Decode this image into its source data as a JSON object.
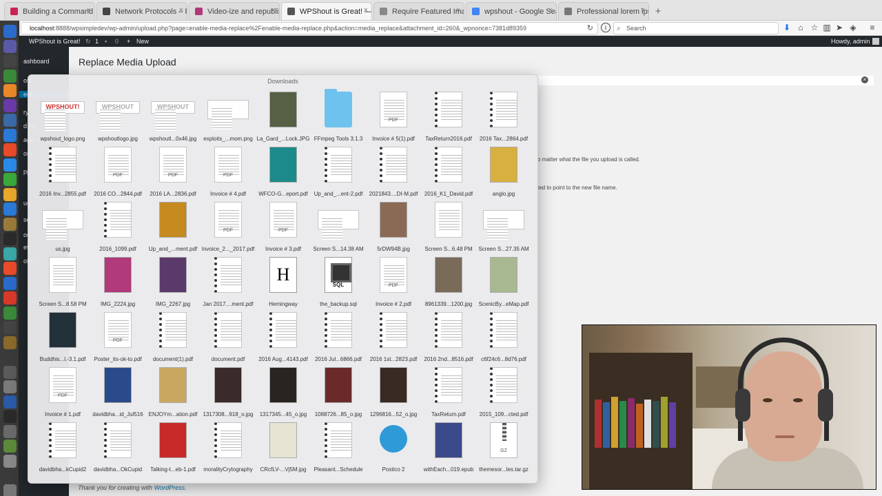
{
  "browser": {
    "tabs": [
      {
        "title": "Building a Command Line Da",
        "color": "#cc2255"
      },
      {
        "title": "Network Protocols – Program",
        "color": "#444444"
      },
      {
        "title": "Video-ize and republish this",
        "color": "#b0397a"
      },
      {
        "title": "WPShout is Great! — WordPres",
        "color": "#555555",
        "active": true
      },
      {
        "title": "Require Featured Image Page ‹ W",
        "color": "#888888"
      },
      {
        "title": "wpshout - Google Search",
        "color": "#4285f4"
      },
      {
        "title": "Professional lorem ipsum gen",
        "color": "#777777"
      }
    ],
    "new_tab": "+",
    "close_glyph": "×",
    "url_host": "localhost",
    "url_rest": ":8888/wpsimpledev/wp-admin/upload.php?page=enable-media-replace%2Fenable-media-replace.php&action=media_replace&attachment_id=260&_wpnonce=7381d89359",
    "search_placeholder": "Search"
  },
  "admin_bar": {
    "site_name": "WPShout is Great!",
    "updates": "1",
    "comments": "0",
    "new_label": "New",
    "greeting": "Howdy, admin"
  },
  "wp_menu": {
    "items": [
      "ashboard",
      "ost",
      "edi",
      "ry",
      "d Ne",
      "age",
      "om",
      "pp",
      "ug",
      "se",
      "oo",
      "ett",
      "olla"
    ]
  },
  "page": {
    "title": "Replace Media Upload",
    "text1": "o matter what the file you upload is called.",
    "text2": "ted to point to the new file name.",
    "footer_prefix": "Thank you for creating with",
    "footer_link": "WordPress",
    "footer_suffix": "."
  },
  "stack": {
    "title": "Downloads",
    "items": [
      {
        "name": "wpshout_logo.png",
        "kind": "logo",
        "label": "WPSHOUT!"
      },
      {
        "name": "wpshoutlogo.jpg",
        "kind": "logo",
        "label": "WPSHOUT"
      },
      {
        "name": "wpshoutl...0x46.jpg",
        "kind": "logo",
        "label": "WPSHOUT"
      },
      {
        "name": "exploits_...mom.png",
        "kind": "wide"
      },
      {
        "name": "La_Gard_...Lock.JPG",
        "kind": "photo",
        "color": "#556044"
      },
      {
        "name": "FFmpeg Tools 3.1.3",
        "kind": "folder"
      },
      {
        "name": "Invoice # 5(1).pdf",
        "kind": "pdf",
        "label": "PDF"
      },
      {
        "name": "TaxReturn2016.pdf",
        "kind": "spiral"
      },
      {
        "name": "2016 Tax...2864.pdf",
        "kind": "spiral"
      },
      {
        "name": "2016 Inv...2855.pdf",
        "kind": "spiral"
      },
      {
        "name": "2016 CO...2844.pdf",
        "kind": "pdf",
        "label": "PDF"
      },
      {
        "name": "2016 LA...2836.pdf",
        "kind": "pdf",
        "label": "PDF"
      },
      {
        "name": "Invoice # 4.pdf",
        "kind": "pdf",
        "label": "PDF"
      },
      {
        "name": "WFCO-G...eport.pdf",
        "kind": "photo",
        "color": "#1c8a8a"
      },
      {
        "name": "Up_and_...ent-2.pdf",
        "kind": "spiral"
      },
      {
        "name": "2021843....DI-M.pdf",
        "kind": "spiral"
      },
      {
        "name": "2016_K1_David.pdf",
        "kind": "spiral"
      },
      {
        "name": "anglo.jpg",
        "kind": "photo",
        "color": "#d8b040"
      },
      {
        "name": "us.jpg",
        "kind": "wide"
      },
      {
        "name": "2016_1099.pdf",
        "kind": "spiral"
      },
      {
        "name": "Up_and_...ment.pdf",
        "kind": "photo",
        "color": "#c58a20"
      },
      {
        "name": "Invoice_2..._2017.pdf",
        "kind": "pdf",
        "label": "PDF"
      },
      {
        "name": "Invoice # 3.pdf",
        "kind": "pdf",
        "label": "PDF"
      },
      {
        "name": "Screen S...14.38 AM",
        "kind": "wide"
      },
      {
        "name": "5rDW94B.jpg",
        "kind": "photo",
        "color": "#8a6a55"
      },
      {
        "name": "Screen S...6.48 PM",
        "kind": "doc"
      },
      {
        "name": "Screen S...27.35 AM",
        "kind": "wide"
      },
      {
        "name": "Screen S...8.58 PM",
        "kind": "doc"
      },
      {
        "name": "IMG_2224.jpg",
        "kind": "photo",
        "color": "#b03a7a"
      },
      {
        "name": "IMG_2267.jpg",
        "kind": "photo",
        "color": "#5a3a6a"
      },
      {
        "name": "Jan 2017....ment.pdf",
        "kind": "spiral"
      },
      {
        "name": "Hemingway",
        "kind": "hem",
        "label": "H"
      },
      {
        "name": "the_backup.sql",
        "kind": "sql",
        "label": "SQL"
      },
      {
        "name": "Invoice # 2.pdf",
        "kind": "pdf",
        "label": "PDF"
      },
      {
        "name": "8961339...1200.jpg",
        "kind": "photo",
        "color": "#7a6a58"
      },
      {
        "name": "ScenicBy...eMap.pdf",
        "kind": "photo",
        "color": "#a8b890"
      },
      {
        "name": "Buddhis...l.-3.1.pdf",
        "kind": "photo",
        "color": "#22303a"
      },
      {
        "name": "Poster_its-ok-to.pdf",
        "kind": "pdf",
        "label": "PDF"
      },
      {
        "name": "document(1).pdf",
        "kind": "spiral"
      },
      {
        "name": "document.pdf",
        "kind": "spiral"
      },
      {
        "name": "2016 Aug...4143.pdf",
        "kind": "spiral"
      },
      {
        "name": "2016 Jul...6866.pdf",
        "kind": "spiral"
      },
      {
        "name": "2016 1st...2823.pdf",
        "kind": "spiral"
      },
      {
        "name": "2016 2nd...8516.pdf",
        "kind": "spiral"
      },
      {
        "name": "c6f24c6...8d76.pdf",
        "kind": "spiral"
      },
      {
        "name": "Invoice # 1.pdf",
        "kind": "pdf",
        "label": "PDF"
      },
      {
        "name": "davidbha...id_Jul516",
        "kind": "photo",
        "color": "#2a4a8a"
      },
      {
        "name": "ENJOYm...ation.pdf",
        "kind": "photo",
        "color": "#c8a860"
      },
      {
        "name": "1317308...918_o.jpg",
        "kind": "photo",
        "color": "#3a2a2a"
      },
      {
        "name": "1317345...45_o.jpg",
        "kind": "photo",
        "color": "#2a2420"
      },
      {
        "name": "1088726...85_o.jpg",
        "kind": "photo",
        "color": "#6a2a2a"
      },
      {
        "name": "1296816...52_o.jpg",
        "kind": "photo",
        "color": "#3a2a24"
      },
      {
        "name": "TaxReturn.pdf",
        "kind": "spiral"
      },
      {
        "name": "2015_109...cted.pdf",
        "kind": "spiral"
      },
      {
        "name": "davidbha...kCupid2",
        "kind": "spiral"
      },
      {
        "name": "davidbha...OkCupid",
        "kind": "spiral"
      },
      {
        "name": "Talking-t...eb-1.pdf",
        "kind": "photo",
        "color": "#c82a2a"
      },
      {
        "name": "moralityCrytography",
        "kind": "spiral"
      },
      {
        "name": "CRcfLV-...Vj5M.jpg",
        "kind": "photo",
        "color": "#e8e4d4"
      },
      {
        "name": "Pleasant...Schedule",
        "kind": "spiral"
      },
      {
        "name": "Postico 2",
        "kind": "elephant"
      },
      {
        "name": "withEach...019.epub",
        "kind": "photo",
        "color": "#3a4a8a"
      },
      {
        "name": "themesor...les.tar.gz",
        "kind": "gz",
        "label": "GZ"
      }
    ]
  }
}
